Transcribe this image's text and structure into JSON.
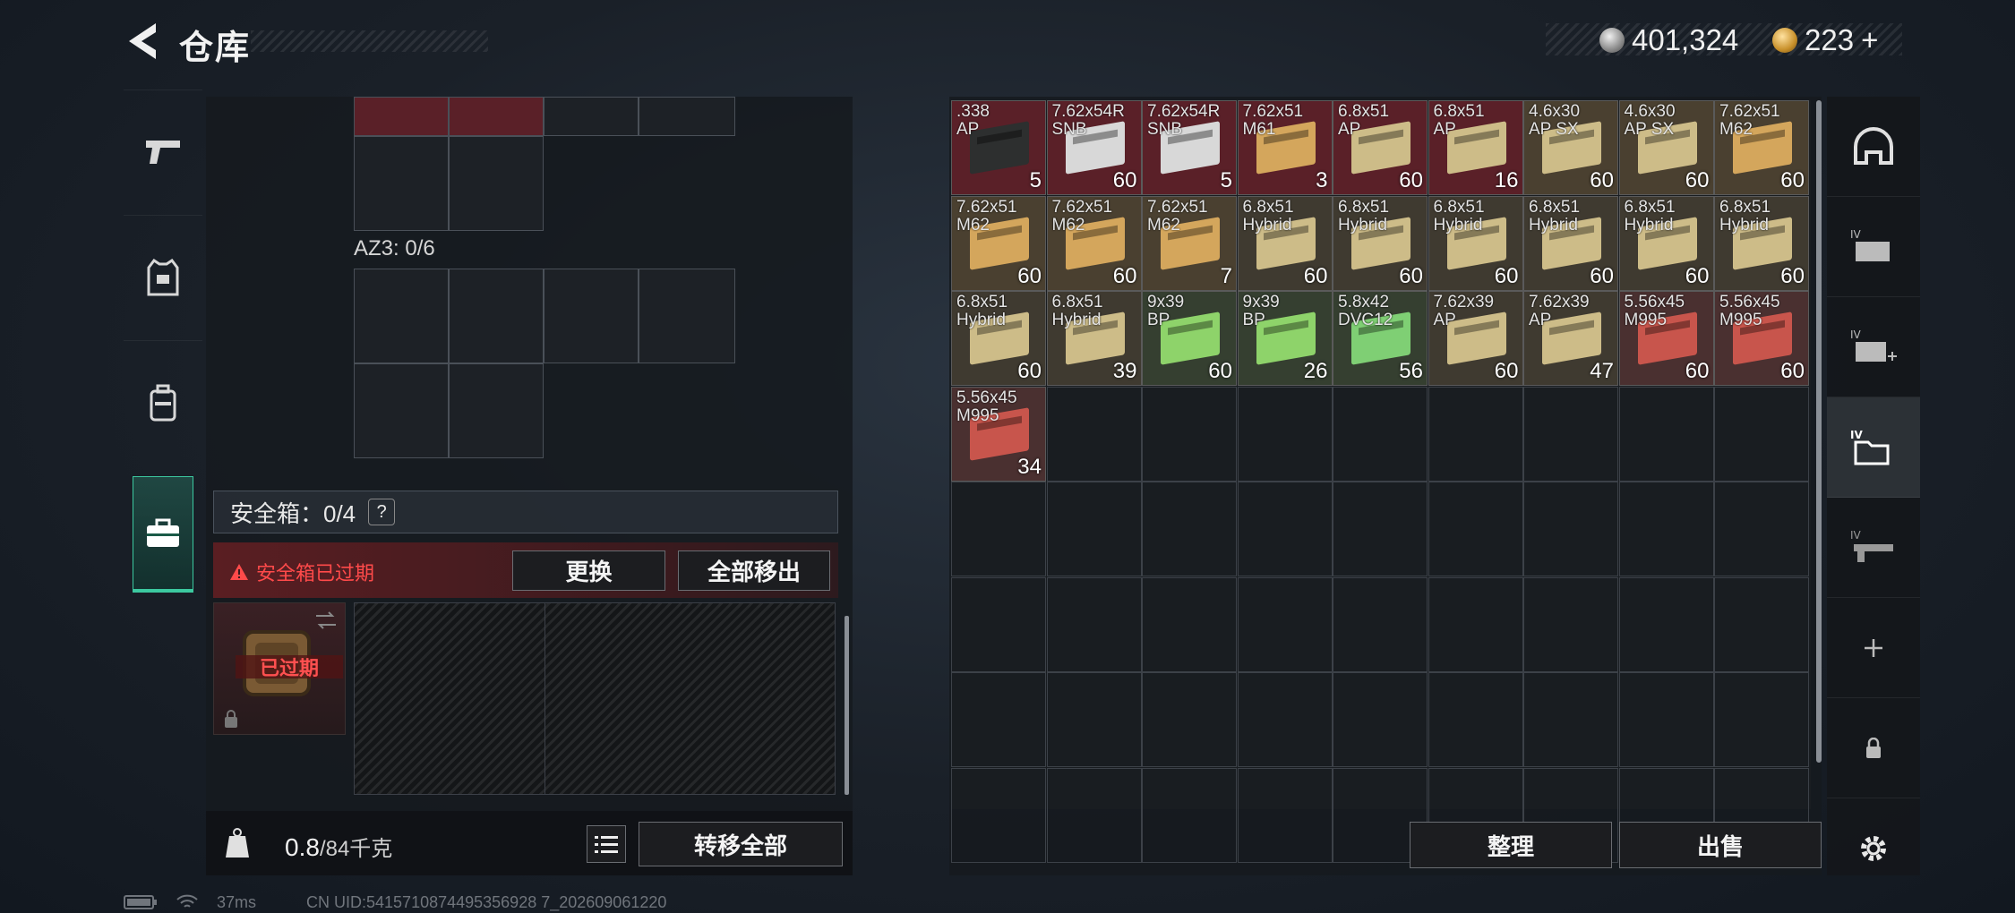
{
  "header": {
    "title": "仓库"
  },
  "currency": {
    "silver": "401,324",
    "gold": "223",
    "gold_add": "+"
  },
  "left_nav": {
    "items": [
      {
        "icon": "pistol-icon"
      },
      {
        "icon": "vest-icon"
      },
      {
        "icon": "backpack-icon"
      },
      {
        "icon": "briefcase-icon",
        "active": true
      }
    ]
  },
  "container": {
    "az3_label": "AZ3: 0/6",
    "safebox_label": "安全箱：0/4",
    "help": "?",
    "expired_notice": "安全箱已过期",
    "swap_label": "更换",
    "move_all_label": "全部移出",
    "case_expired": "已过期"
  },
  "footer_left": {
    "weight_value": "0.8",
    "weight_unit": "/84千克",
    "transfer_all_label": "转移全部"
  },
  "stash": {
    "items": [
      {
        "name": ".338\nAP",
        "qty": "5",
        "bg": "#5a2028",
        "box": "#2d2f2f"
      },
      {
        "name": "7.62x54R\nSNB",
        "qty": "60",
        "bg": "#5a2028",
        "box": "#d8d8d8"
      },
      {
        "name": "7.62x54R\nSNB",
        "qty": "5",
        "bg": "#5a2028",
        "box": "#d8d8d8"
      },
      {
        "name": "7.62x51\nM61",
        "qty": "3",
        "bg": "#5a2028",
        "box": "#d4a65c"
      },
      {
        "name": "6.8x51\nAP",
        "qty": "60",
        "bg": "#5a2028",
        "box": "#cdbc88"
      },
      {
        "name": "6.8x51\nAP",
        "qty": "16",
        "bg": "#5a2028",
        "box": "#cdbc88"
      },
      {
        "name": "4.6x30\nAP SX",
        "qty": "60",
        "bg": "#4a4030",
        "box": "#cdbc88"
      },
      {
        "name": "4.6x30\nAP SX",
        "qty": "60",
        "bg": "#4a4030",
        "box": "#cdbc88"
      },
      {
        "name": "7.62x51\nM62",
        "qty": "60",
        "bg": "#4a4030",
        "box": "#d4a65c"
      },
      {
        "name": "7.62x51\nM62",
        "qty": "60",
        "bg": "#4a4030",
        "box": "#d4a65c"
      },
      {
        "name": "7.62x51\nM62",
        "qty": "60",
        "bg": "#4a4030",
        "box": "#d4a65c"
      },
      {
        "name": "7.62x51\nM62",
        "qty": "7",
        "bg": "#4a4030",
        "box": "#d4a65c"
      },
      {
        "name": "6.8x51\nHybrid",
        "qty": "60",
        "bg": "#3f3a30",
        "box": "#cdbc88"
      },
      {
        "name": "6.8x51\nHybrid",
        "qty": "60",
        "bg": "#3f3a30",
        "box": "#cdbc88"
      },
      {
        "name": "6.8x51\nHybrid",
        "qty": "60",
        "bg": "#3f3a30",
        "box": "#cdbc88"
      },
      {
        "name": "6.8x51\nHybrid",
        "qty": "60",
        "bg": "#3f3a30",
        "box": "#cdbc88"
      },
      {
        "name": "6.8x51\nHybrid",
        "qty": "60",
        "bg": "#3f3a30",
        "box": "#cdbc88"
      },
      {
        "name": "6.8x51\nHybrid",
        "qty": "60",
        "bg": "#3f3a30",
        "box": "#cdbc88"
      },
      {
        "name": "6.8x51\nHybrid",
        "qty": "60",
        "bg": "#3f3a30",
        "box": "#cdbc88"
      },
      {
        "name": "6.8x51\nHybrid",
        "qty": "39",
        "bg": "#3f3a30",
        "box": "#cdbc88"
      },
      {
        "name": "9x39\nBP",
        "qty": "60",
        "bg": "#353f30",
        "box": "#8ed36a"
      },
      {
        "name": "9x39\nBP",
        "qty": "26",
        "bg": "#353f30",
        "box": "#8ed36a"
      },
      {
        "name": "5.8x42\nDVC12",
        "qty": "56",
        "bg": "#353f30",
        "box": "#7fcf74"
      },
      {
        "name": "7.62x39\nAP",
        "qty": "60",
        "bg": "#3f3a30",
        "box": "#cdbc88"
      },
      {
        "name": "7.62x39\nAP",
        "qty": "47",
        "bg": "#3f3a30",
        "box": "#cdbc88"
      },
      {
        "name": "5.56x45\nM995",
        "qty": "60",
        "bg": "#4a3030",
        "box": "#c8554c"
      },
      {
        "name": "5.56x45\nM995",
        "qty": "60",
        "bg": "#4a3030",
        "box": "#c8554c"
      },
      {
        "name": "5.56x45\nM995",
        "qty": "34",
        "bg": "#4a3030",
        "box": "#c8554c"
      }
    ]
  },
  "stash_actions": {
    "sort_label": "整理",
    "sell_label": "出售"
  },
  "right_tabs": [
    {
      "icon": "helmet-icon"
    },
    {
      "icon": "case-iv-icon"
    },
    {
      "icon": "case-iv-add-icon"
    },
    {
      "icon": "case-iv-folder-icon",
      "active": true
    },
    {
      "icon": "case-iv-weapon-icon"
    },
    {
      "icon": "plus-icon"
    },
    {
      "icon": "lock-icon"
    },
    {
      "icon": "gear-icon"
    }
  ],
  "statusbar": {
    "ping": "37ms",
    "uid": "CN UID:5415710874495356928 7_202609061220"
  }
}
